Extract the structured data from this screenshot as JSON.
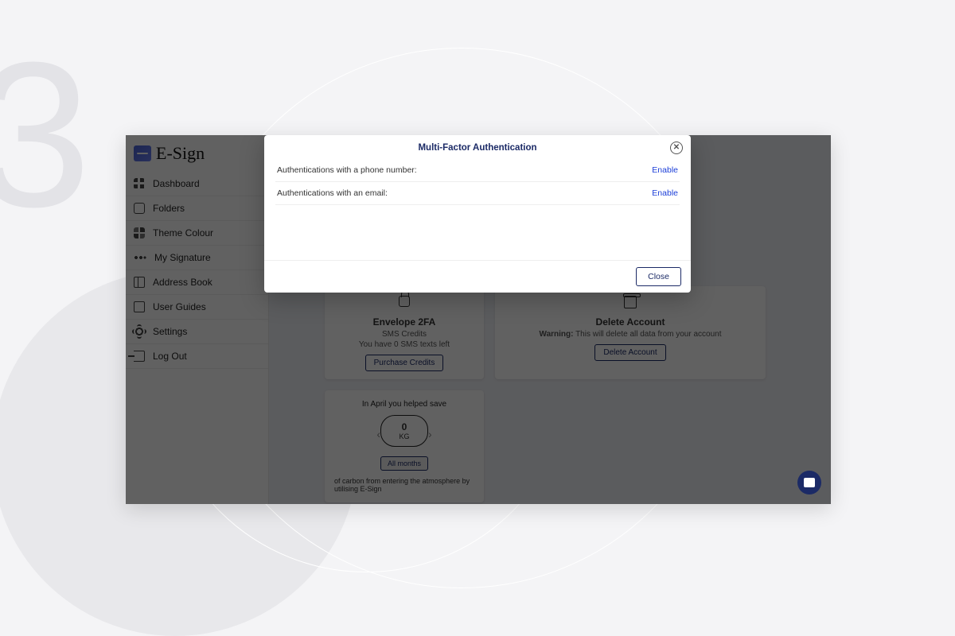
{
  "bg": {
    "step_number": "3"
  },
  "brand": {
    "name": "E-Sign"
  },
  "sidebar": {
    "items": [
      {
        "label": "Dashboard"
      },
      {
        "label": "Folders"
      },
      {
        "label": "Theme Colour"
      },
      {
        "label": "My Signature"
      },
      {
        "label": "Address Book"
      },
      {
        "label": "User Guides"
      },
      {
        "label": "Settings"
      },
      {
        "label": "Log Out"
      }
    ]
  },
  "cards": {
    "envelope2fa": {
      "title": "Envelope 2FA",
      "sub1": "SMS Credits",
      "sub2": "You have 0 SMS texts left",
      "button": "Purchase Credits"
    },
    "delete_account": {
      "title": "Delete Account",
      "warning_bold": "Warning:",
      "warning_rest": "This will delete all data from your account",
      "button": "Delete Account"
    },
    "carbon": {
      "headline": "In April you helped save",
      "value": "0",
      "unit": "KG",
      "all_months": "All months",
      "footer": "of carbon from entering the atmosphere by utilising E-Sign"
    }
  },
  "modal": {
    "title": "Multi-Factor Authentication",
    "rows": [
      {
        "label": "Authentications with a phone number:",
        "action": "Enable"
      },
      {
        "label": "Authentications with an email:",
        "action": "Enable"
      }
    ],
    "close_button": "Close"
  }
}
